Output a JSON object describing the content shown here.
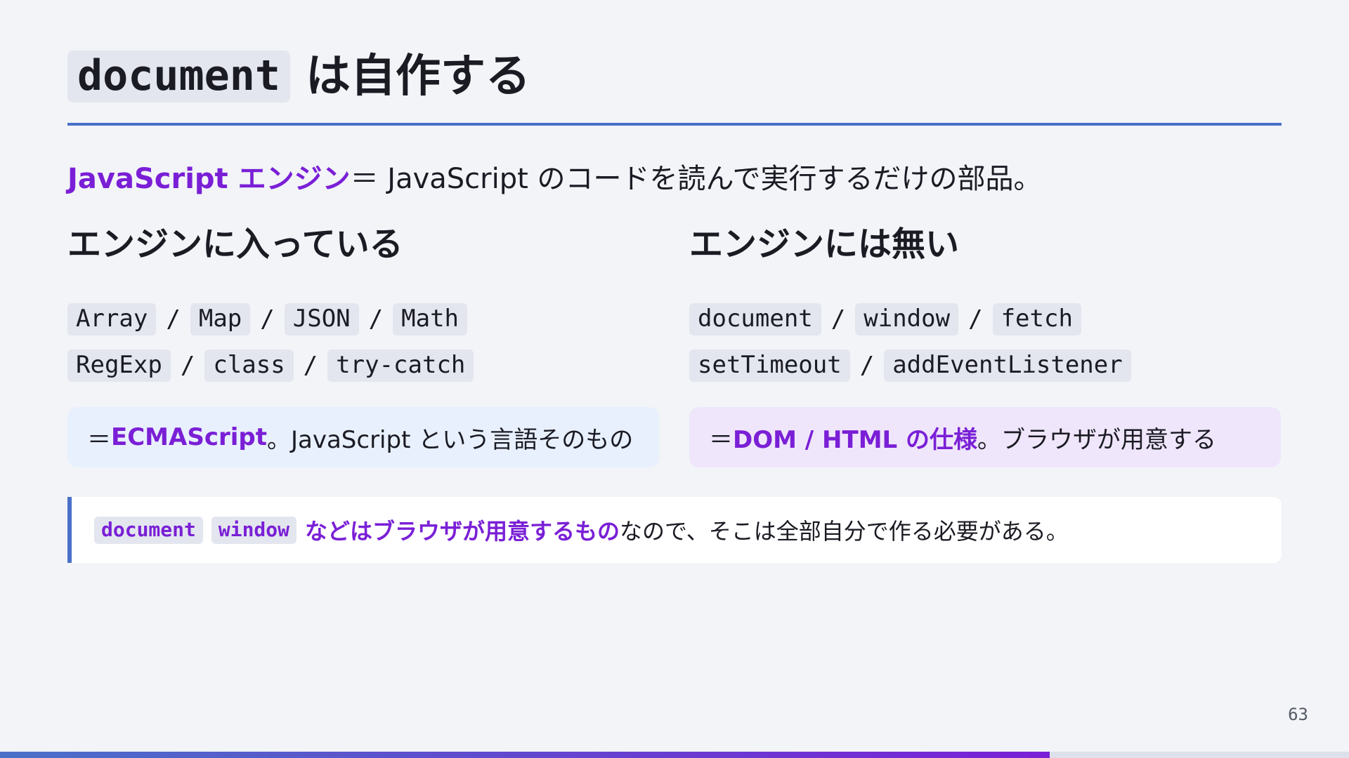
{
  "title": {
    "code": "document",
    "text": "は自作する"
  },
  "lead": {
    "highlight": "JavaScript エンジン",
    "text": "＝ JavaScript のコードを読んで実行するだけの部品。"
  },
  "left": {
    "heading": "エンジンに入っている",
    "line1": [
      "Array",
      "Map",
      "JSON",
      "Math"
    ],
    "line2": [
      "RegExp",
      "class",
      "try-catch"
    ],
    "box": {
      "prefix": "＝ ",
      "highlight": "ECMAScript",
      "text": "。JavaScript という言語そのもの"
    }
  },
  "right": {
    "heading": "エンジンには無い",
    "line1": [
      "document",
      "window",
      "fetch"
    ],
    "line2": [
      "setTimeout",
      "addEventListener"
    ],
    "box": {
      "prefix": "＝ ",
      "highlight": "DOM / HTML の仕様",
      "text": "。ブラウザが用意する"
    }
  },
  "separator": "/",
  "note": {
    "chip1": "document",
    "chip2": "window",
    "highlight": "などはブラウザが用意するもの",
    "text": "なので、そこは全部自分で作る必要がある。"
  },
  "page_number": "63",
  "progress": {
    "fraction": 0.778
  },
  "colors": {
    "accent": "#7a1fd6",
    "rule": "#4a70c8",
    "background": "#f2f4f8"
  }
}
